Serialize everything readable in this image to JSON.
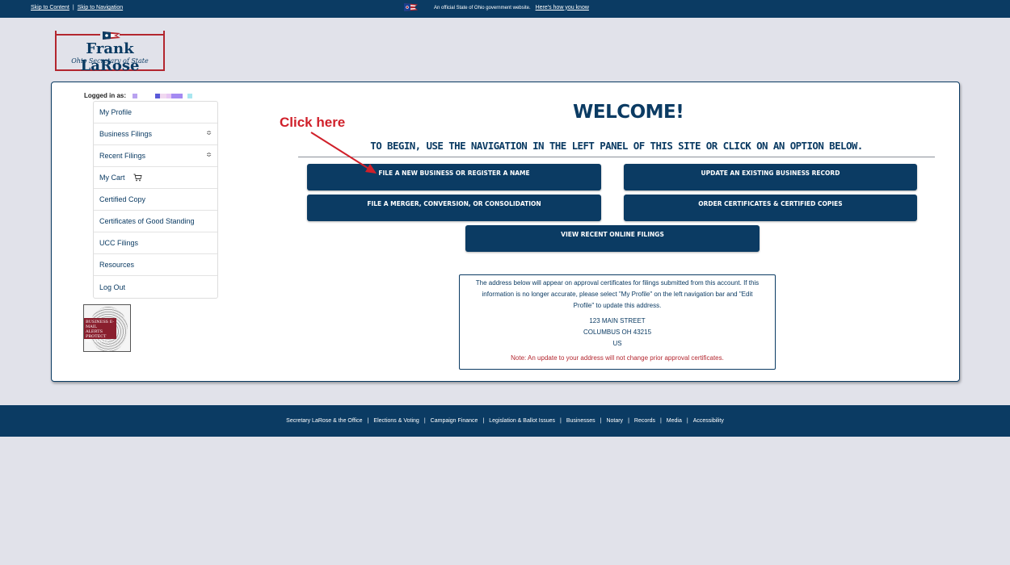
{
  "topbar": {
    "skip_content": "Skip to Content",
    "skip_sep": "|",
    "skip_nav": "Skip to Navigation",
    "official_text": "An official State of Ohio government website.",
    "official_link": "Here's how you know"
  },
  "logo": {
    "name": "Frank LaRose",
    "subtitle": "Ohio Secretary of State"
  },
  "sidebar": {
    "logged_in_label": "Logged in as:",
    "items": [
      {
        "label": "My Profile"
      },
      {
        "label": "Business Filings"
      },
      {
        "label": "Recent Filings"
      },
      {
        "label": "My Cart"
      },
      {
        "label": "Certified Copy"
      },
      {
        "label": "Certificates of Good Standing"
      },
      {
        "label": "UCC Filings"
      },
      {
        "label": "Resources"
      },
      {
        "label": "Log Out"
      }
    ],
    "alerts_image_text": "BUSINESS E-MAIL ALERTS PROTECT YOURSELF"
  },
  "main": {
    "welcome": "WELCOME!",
    "annotation": "Click here",
    "instructions": "TO BEGIN, USE THE NAVIGATION IN THE LEFT PANEL OF THIS SITE OR CLICK ON AN OPTION BELOW.",
    "buttons": {
      "new_business": "FILE A NEW BUSINESS OR REGISTER A NAME",
      "update_record": "UPDATE AN EXISTING BUSINESS RECORD",
      "merger": "FILE A MERGER, CONVERSION, OR CONSOLIDATION",
      "certificates": "ORDER CERTIFICATES & CERTIFIED COPIES",
      "recent": "VIEW RECENT ONLINE FILINGS"
    },
    "address_box": {
      "message": "The address below will appear on approval certificates for filings submitted from this account. If this information is no longer accurate, please select \"My Profile\" on the left navigation bar and \"Edit Profile\" to update this address.",
      "street": "123 MAIN STREET",
      "city": "COLUMBUS OH 43215",
      "country": "US",
      "note": "Note: An update to your address will not change prior approval certificates."
    }
  },
  "footer": {
    "links": [
      "Secretary LaRose & the Office",
      "Elections & Voting",
      "Campaign Finance",
      "Legislation & Ballot Issues",
      "Businesses",
      "Notary",
      "Records",
      "Media",
      "Accessibility"
    ]
  },
  "colors": {
    "brand_navy": "#0b3b63",
    "brand_red": "#b3262f",
    "annotation_red": "#d0202a",
    "page_bg": "#e1e2ea"
  }
}
